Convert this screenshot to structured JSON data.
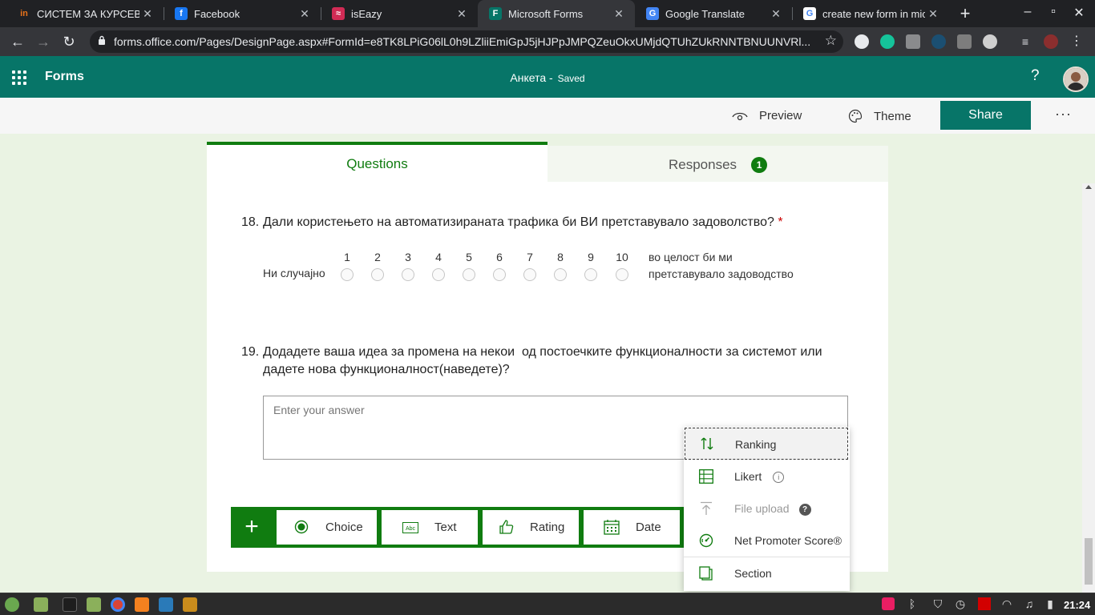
{
  "browser": {
    "tabs": [
      {
        "title": "СИСТЕМ ЗА КУРСЕВИ",
        "favicon_text": "in",
        "favicon_color": "#e8731a",
        "active": false
      },
      {
        "title": "Facebook",
        "favicon_text": "f",
        "favicon_color": "#1877f2",
        "active": false
      },
      {
        "title": "isEazy",
        "favicon_text": "≈",
        "favicon_color": "#d12b55",
        "active": false
      },
      {
        "title": "Microsoft Forms",
        "favicon_text": "F",
        "favicon_color": "#077568",
        "active": true
      },
      {
        "title": "Google Translate",
        "favicon_text": "G",
        "favicon_color": "#4285f4",
        "active": false
      },
      {
        "title": "create new form in mic",
        "favicon_text": "G",
        "favicon_color": "#ffffff",
        "active": false
      }
    ],
    "close_glyph": "✕",
    "new_tab_glyph": "+",
    "url": "forms.office.com/Pages/DesignPage.aspx#FormId=e8TK8LPiG06lL0h9LZliiEmiGpJ5jHJPpJMPQZeuOkxUMjdQTUhZUkRNNTBNUUNVRl..."
  },
  "app": {
    "name": "Forms",
    "doc_title": "Анкета",
    "doc_separator": "-",
    "save_status": "Saved",
    "help_glyph": "?"
  },
  "toolbar": {
    "preview_label": "Preview",
    "theme_label": "Theme",
    "share_label": "Share",
    "more_glyph": "···"
  },
  "tabs": {
    "questions_label": "Questions",
    "responses_label": "Responses",
    "responses_count": "1"
  },
  "questions": [
    {
      "number": "18.",
      "text": "Дали користењето на автоматизираната трафика би ВИ претставувало задоволство?",
      "required_mark": "*",
      "type": "rating",
      "scale": [
        "1",
        "2",
        "3",
        "4",
        "5",
        "6",
        "7",
        "8",
        "9",
        "10"
      ],
      "left_label": "Ни случајно",
      "right_label_line1": "во целост би ми",
      "right_label_line2": "претставувало задоводство"
    },
    {
      "number": "19.",
      "text_line1": "Додадете ваша идеа за промена на некои  од постоечките функционалности за системот или",
      "text_line2": "дадете нова функционалност(наведете)?",
      "type": "text",
      "placeholder": "Enter your answer"
    }
  ],
  "add_question": {
    "plus_glyph": "+",
    "types": [
      {
        "label": "Choice",
        "icon": "radio-icon"
      },
      {
        "label": "Text",
        "icon": "text-abc-icon"
      },
      {
        "label": "Rating",
        "icon": "thumbs-up-icon"
      },
      {
        "label": "Date",
        "icon": "calendar-icon"
      }
    ]
  },
  "more_types_menu": {
    "items": [
      {
        "label": "Ranking",
        "icon": "ranking-icon",
        "state": "focused"
      },
      {
        "label": "Likert",
        "icon": "likert-grid-icon",
        "info": "i"
      },
      {
        "label": "File upload",
        "icon": "upload-icon",
        "state": "disabled",
        "info": "?"
      },
      {
        "label": "Net Promoter Score®",
        "icon": "nps-gauge-icon"
      },
      {
        "label": "Section",
        "icon": "section-icon"
      }
    ]
  },
  "taskbar": {
    "clock": "21:24"
  },
  "colors": {
    "forms_teal": "#077568",
    "forms_green": "#107c10",
    "page_bg": "#eaf3e3",
    "required_red": "#cc0000"
  }
}
